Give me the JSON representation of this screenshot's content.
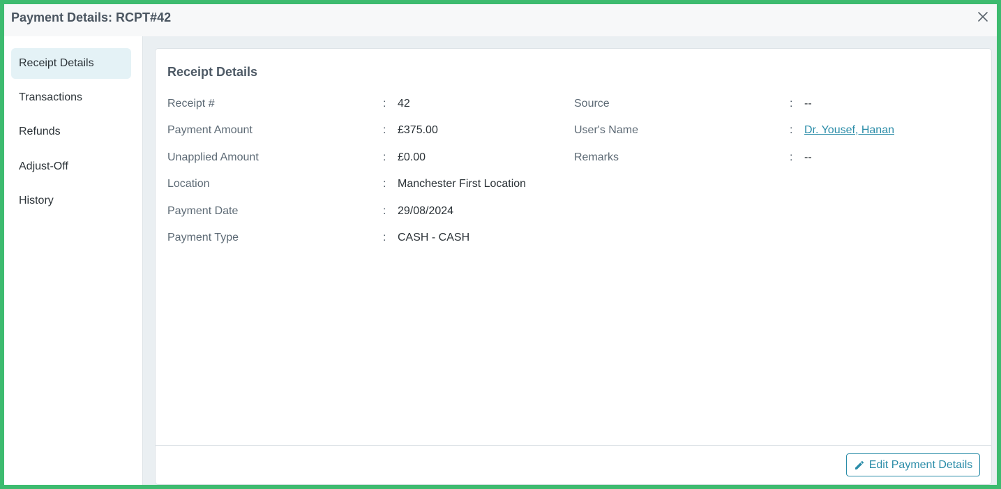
{
  "dialog": {
    "title": "Payment Details: RCPT#42"
  },
  "sidebar": {
    "items": [
      {
        "label": "Receipt Details",
        "active": true
      },
      {
        "label": "Transactions",
        "active": false
      },
      {
        "label": "Refunds",
        "active": false
      },
      {
        "label": "Adjust-Off",
        "active": false
      },
      {
        "label": "History",
        "active": false
      }
    ]
  },
  "receipt": {
    "section_title": "Receipt Details",
    "left_fields": [
      {
        "label": "Receipt #",
        "value": "42"
      },
      {
        "label": "Payment Amount",
        "value": "£375.00"
      },
      {
        "label": "Unapplied Amount",
        "value": "£0.00"
      },
      {
        "label": "Location",
        "value": "Manchester First Location"
      },
      {
        "label": "Payment Date",
        "value": "29/08/2024"
      },
      {
        "label": "Payment Type",
        "value": "CASH - CASH"
      }
    ],
    "right_fields": [
      {
        "label": "Source",
        "value": "--"
      },
      {
        "label": "User's Name",
        "value": "Dr. Yousef, Hanan"
      },
      {
        "label": "Remarks",
        "value": "--"
      }
    ],
    "separator": ":"
  },
  "footer": {
    "edit_label": "Edit Payment Details"
  },
  "colors": {
    "accent": "#2a8ca8",
    "active_nav_bg": "#e4f2f6",
    "frame_border": "#3dbb6f"
  },
  "icons": {
    "close": "close-icon",
    "edit": "pencil-icon"
  }
}
